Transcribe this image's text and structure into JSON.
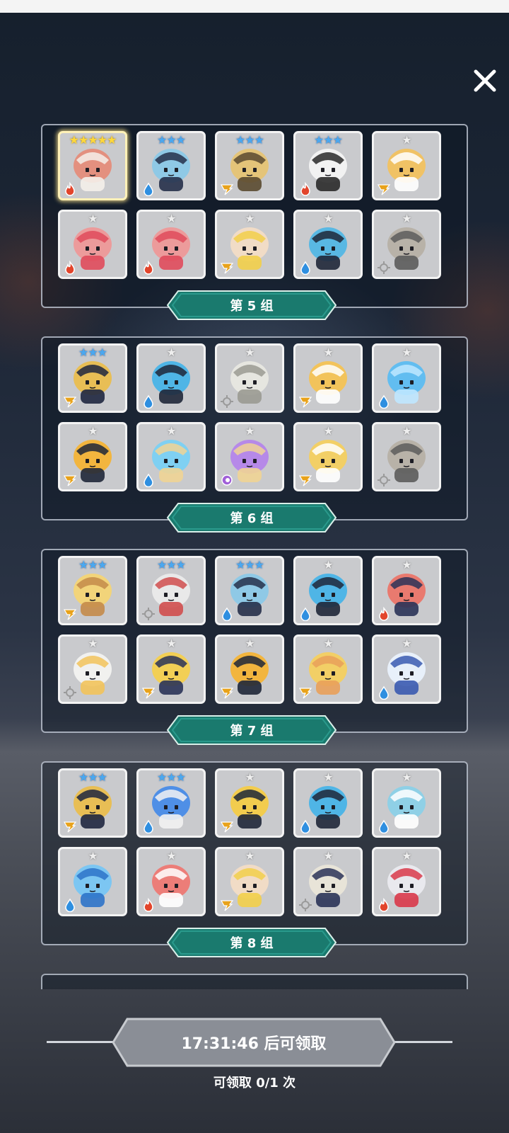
{
  "close": {
    "icon": "close-icon"
  },
  "groups": [
    {
      "label": "第 5 组",
      "cards": [
        {
          "stars": "★★★★★",
          "tier": "gold",
          "element": "fire",
          "color": "#e3907f",
          "accent": "#f4f0ea",
          "highlight": true
        },
        {
          "stars": "★★★",
          "tier": "blue",
          "element": "water",
          "color": "#8fc9e6",
          "accent": "#26304a"
        },
        {
          "stars": "★★★",
          "tier": "blue",
          "element": "thunder",
          "color": "#e4c479",
          "accent": "#5a4a30"
        },
        {
          "stars": "★★★",
          "tier": "blue",
          "element": "fire",
          "color": "#f2f2f2",
          "accent": "#2a2a2a"
        },
        {
          "stars": "★",
          "tier": "gray",
          "element": "thunder",
          "color": "#f0c265",
          "accent": "#ffffff"
        },
        {
          "stars": "★",
          "tier": "gray",
          "element": "fire",
          "color": "#ec9b9b",
          "accent": "#e04b5c"
        },
        {
          "stars": "★",
          "tier": "gray",
          "element": "fire",
          "color": "#ec9b9b",
          "accent": "#e04b5c"
        },
        {
          "stars": "★",
          "tier": "gray",
          "element": "thunder",
          "color": "#f1dcc6",
          "accent": "#f2cf4a"
        },
        {
          "stars": "★",
          "tier": "gray",
          "element": "water",
          "color": "#59b8e3",
          "accent": "#1f2738"
        },
        {
          "stars": "★",
          "tier": "gray",
          "element": "light",
          "color": "#b8b2a8",
          "accent": "#5c5c5c"
        }
      ]
    },
    {
      "label": "第 6 组",
      "cards": [
        {
          "stars": "★★★",
          "tier": "blue",
          "element": "thunder",
          "color": "#e8be55",
          "accent": "#1f2740"
        },
        {
          "stars": "★",
          "tier": "gray",
          "element": "water",
          "color": "#4fb5e6",
          "accent": "#1f2738"
        },
        {
          "stars": "★",
          "tier": "gray",
          "element": "light",
          "color": "#e6e6e0",
          "accent": "#9a9a92"
        },
        {
          "stars": "★",
          "tier": "gray",
          "element": "thunder",
          "color": "#f2c35b",
          "accent": "#ffffff"
        },
        {
          "stars": "★",
          "tier": "gray",
          "element": "water",
          "color": "#62bdf0",
          "accent": "#bfe7ff"
        },
        {
          "stars": "★",
          "tier": "gray",
          "element": "thunder",
          "color": "#f2b53e",
          "accent": "#1f2738"
        },
        {
          "stars": "★",
          "tier": "gray",
          "element": "water",
          "color": "#7fd0f2",
          "accent": "#f0d495"
        },
        {
          "stars": "★",
          "tier": "gray",
          "element": "spirit",
          "color": "#b689e8",
          "accent": "#f0d495"
        },
        {
          "stars": "★",
          "tier": "gray",
          "element": "thunder",
          "color": "#f2cf66",
          "accent": "#ffffff"
        },
        {
          "stars": "★",
          "tier": "gray",
          "element": "light",
          "color": "#b8b2a8",
          "accent": "#5c5c5c"
        }
      ]
    },
    {
      "label": "第 7 组",
      "cards": [
        {
          "stars": "★★★",
          "tier": "blue",
          "element": "thunder",
          "color": "#f2d47a",
          "accent": "#c48b4a"
        },
        {
          "stars": "★★★",
          "tier": "blue",
          "element": "light",
          "color": "#e9e9e9",
          "accent": "#d04e4e"
        },
        {
          "stars": "★★★",
          "tier": "blue",
          "element": "water",
          "color": "#8fc9e6",
          "accent": "#26304a"
        },
        {
          "stars": "★",
          "tier": "gray",
          "element": "water",
          "color": "#4fb5e6",
          "accent": "#1f2738"
        },
        {
          "stars": "★",
          "tier": "gray",
          "element": "fire",
          "color": "#e97a6f",
          "accent": "#2a3358"
        },
        {
          "stars": "★",
          "tier": "gray",
          "element": "light",
          "color": "#f1f1ef",
          "accent": "#f2c35b"
        },
        {
          "stars": "★",
          "tier": "gray",
          "element": "thunder",
          "color": "#f2cf55",
          "accent": "#2a3358"
        },
        {
          "stars": "★",
          "tier": "gray",
          "element": "thunder",
          "color": "#f2b53e",
          "accent": "#1f2738"
        },
        {
          "stars": "★",
          "tier": "gray",
          "element": "thunder",
          "color": "#f2cf66",
          "accent": "#e9a05a"
        },
        {
          "stars": "★",
          "tier": "gray",
          "element": "water",
          "color": "#e8f0fa",
          "accent": "#3a5ab0"
        }
      ]
    },
    {
      "label": "第 8 组",
      "cards": [
        {
          "stars": "★★★",
          "tier": "blue",
          "element": "thunder",
          "color": "#e8be55",
          "accent": "#1f2740"
        },
        {
          "stars": "★★★",
          "tier": "blue",
          "element": "water",
          "color": "#4f8fe6",
          "accent": "#f2f2f2"
        },
        {
          "stars": "★",
          "tier": "gray",
          "element": "thunder",
          "color": "#f2cc4e",
          "accent": "#1f2738"
        },
        {
          "stars": "★",
          "tier": "gray",
          "element": "water",
          "color": "#4fb5e6",
          "accent": "#1f2738"
        },
        {
          "stars": "★",
          "tier": "gray",
          "element": "water",
          "color": "#8fd0e6",
          "accent": "#ffffff"
        },
        {
          "stars": "★",
          "tier": "gray",
          "element": "water",
          "color": "#7cc6f2",
          "accent": "#2e73c9"
        },
        {
          "stars": "★",
          "tier": "gray",
          "element": "fire",
          "color": "#ec7d78",
          "accent": "#ffffff"
        },
        {
          "stars": "★",
          "tier": "gray",
          "element": "thunder",
          "color": "#f1dcc6",
          "accent": "#f2cf4a"
        },
        {
          "stars": "★",
          "tier": "gray",
          "element": "light",
          "color": "#e8e4d8",
          "accent": "#2a3358"
        },
        {
          "stars": "★",
          "tier": "gray",
          "element": "fire",
          "color": "#e9e9ee",
          "accent": "#d9394a"
        }
      ]
    }
  ],
  "footer": {
    "timer_text": "17:31:46 后可领取",
    "claim_count": "可领取 0/1 次"
  },
  "colors": {
    "banner": "#1a7a6e",
    "banner_light": "#2a9a8c",
    "timer_bg": "#8a8e96",
    "water": "#2f8fe0",
    "fire": "#e2452c",
    "thunder": "#e8a21a",
    "light": "#9a9a9a",
    "spirit": "#a060d8"
  }
}
